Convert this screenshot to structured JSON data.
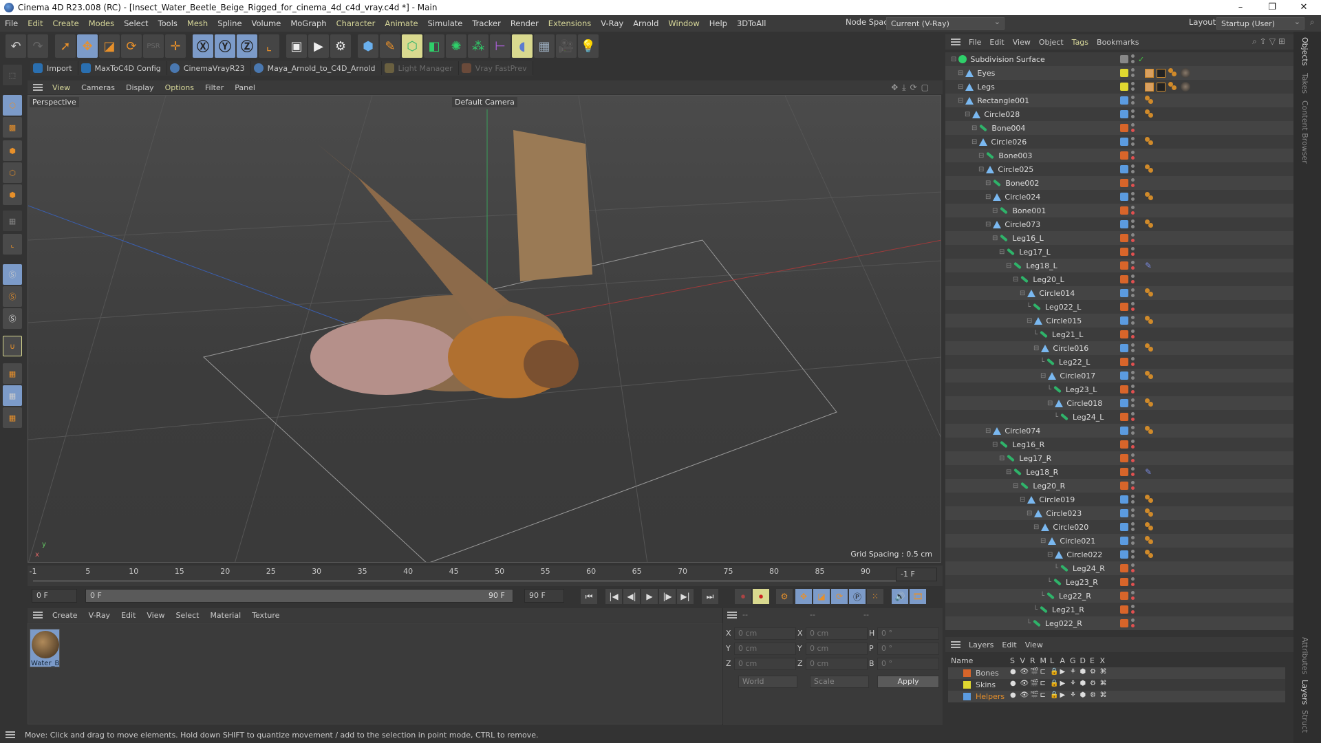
{
  "window": {
    "title": "Cinema 4D R23.008 (RC) - [Insect_Water_Beetle_Beige_Rigged_for_cinema_4d_c4d_vray.c4d *] - Main",
    "minimize": "–",
    "maximize": "❐",
    "close": "✕"
  },
  "menubar": {
    "items": [
      "File",
      "Edit",
      "Create",
      "Modes",
      "Select",
      "Tools",
      "Mesh",
      "Spline",
      "Volume",
      "MoGraph",
      "Character",
      "Animate",
      "Simulate",
      "Tracker",
      "Render",
      "Extensions",
      "V-Ray",
      "Arnold",
      "Window",
      "Help",
      "3DToAll"
    ],
    "node_space_label": "Node Space:",
    "node_space_value": "Current (V-Ray)",
    "layout_label": "Layout:",
    "layout_value": "Startup (User)"
  },
  "plugins": [
    "Import",
    "MaxToC4D Config",
    "CinemaVrayR23",
    "Maya_Arnold_to_C4D_Arnold",
    "Light Manager",
    "Vray FastPrev"
  ],
  "viewport": {
    "menu": [
      "View",
      "Cameras",
      "Display",
      "Options",
      "Filter",
      "Panel"
    ],
    "label": "Perspective",
    "camera": "Default Camera",
    "grid_spacing": "Grid Spacing : 0.5 cm"
  },
  "timeline": {
    "ticks": [
      "-1",
      "5",
      "10",
      "15",
      "20",
      "25",
      "30",
      "35",
      "40",
      "45",
      "50",
      "55",
      "60",
      "65",
      "70",
      "75",
      "80",
      "85",
      "90"
    ],
    "end_field": "-1 F",
    "current_frame": "0 F",
    "slider_start": "0 F",
    "slider_end": "90 F",
    "max_frame": "90 F"
  },
  "material_manager": {
    "menu": [
      "Create",
      "V-Ray",
      "Edit",
      "View",
      "Select",
      "Material",
      "Texture"
    ],
    "materials": [
      {
        "name": "Water_B"
      }
    ]
  },
  "coordinates": {
    "headers": [
      "--",
      "--",
      "--"
    ],
    "pos": {
      "x": "0 cm",
      "y": "0 cm",
      "z": "0 cm"
    },
    "size": {
      "x": "0 cm",
      "y": "0 cm",
      "z": "0 cm"
    },
    "rot": {
      "h": "0 °",
      "p": "0 °",
      "b": "0 °"
    },
    "mode": "World",
    "transform": "Scale",
    "apply": "Apply"
  },
  "status": "Move: Click and drag to move elements. Hold down SHIFT to quantize movement / add to the selection in point mode, CTRL to remove.",
  "object_manager": {
    "menu": [
      "File",
      "Edit",
      "View",
      "Object",
      "Tags",
      "Bookmarks"
    ],
    "objects": [
      {
        "name": "Subdivision Surface",
        "depth": 0,
        "type": "sub",
        "color": "#888888"
      },
      {
        "name": "Eyes",
        "depth": 1,
        "type": "null",
        "color": "#e0d830",
        "tags": "mat"
      },
      {
        "name": "Legs",
        "depth": 1,
        "type": "null",
        "color": "#e0d830",
        "tags": "mat"
      },
      {
        "name": "Rectangle001",
        "depth": 1,
        "type": "null",
        "color": "#5b9be0",
        "tags": "dot"
      },
      {
        "name": "Circle028",
        "depth": 2,
        "type": "null",
        "color": "#5b9be0",
        "tags": "dot"
      },
      {
        "name": "Bone004",
        "depth": 3,
        "type": "bone",
        "color": "#d8652a"
      },
      {
        "name": "Circle026",
        "depth": 3,
        "type": "null",
        "color": "#5b9be0",
        "tags": "dot"
      },
      {
        "name": "Bone003",
        "depth": 4,
        "type": "bone",
        "color": "#d8652a"
      },
      {
        "name": "Circle025",
        "depth": 4,
        "type": "null",
        "color": "#5b9be0",
        "tags": "dot"
      },
      {
        "name": "Bone002",
        "depth": 5,
        "type": "bone",
        "color": "#d8652a"
      },
      {
        "name": "Circle024",
        "depth": 5,
        "type": "null",
        "color": "#5b9be0",
        "tags": "dot"
      },
      {
        "name": "Bone001",
        "depth": 6,
        "type": "bone",
        "color": "#d8652a"
      },
      {
        "name": "Circle073",
        "depth": 5,
        "type": "null",
        "color": "#5b9be0",
        "tags": "dot"
      },
      {
        "name": "Leg16_L",
        "depth": 6,
        "type": "bone",
        "color": "#d8652a"
      },
      {
        "name": "Leg17_L",
        "depth": 7,
        "type": "bone",
        "color": "#d8652a"
      },
      {
        "name": "Leg18_L",
        "depth": 8,
        "type": "bone",
        "color": "#d8652a",
        "tags": "ik"
      },
      {
        "name": "Leg20_L",
        "depth": 9,
        "type": "bone",
        "color": "#d8652a"
      },
      {
        "name": "Circle014",
        "depth": 10,
        "type": "null",
        "color": "#5b9be0",
        "tags": "dot"
      },
      {
        "name": "Leg022_L",
        "depth": 11,
        "type": "bone",
        "color": "#d8652a"
      },
      {
        "name": "Circle015",
        "depth": 11,
        "type": "null",
        "color": "#5b9be0",
        "tags": "dot"
      },
      {
        "name": "Leg21_L",
        "depth": 12,
        "type": "bone",
        "color": "#d8652a"
      },
      {
        "name": "Circle016",
        "depth": 12,
        "type": "null",
        "color": "#5b9be0",
        "tags": "dot"
      },
      {
        "name": "Leg22_L",
        "depth": 13,
        "type": "bone",
        "color": "#d8652a"
      },
      {
        "name": "Circle017",
        "depth": 13,
        "type": "null",
        "color": "#5b9be0",
        "tags": "dot"
      },
      {
        "name": "Leg23_L",
        "depth": 14,
        "type": "bone",
        "color": "#d8652a"
      },
      {
        "name": "Circle018",
        "depth": 14,
        "type": "null",
        "color": "#5b9be0",
        "tags": "dot"
      },
      {
        "name": "Leg24_L",
        "depth": 15,
        "type": "bone",
        "color": "#d8652a"
      },
      {
        "name": "Circle074",
        "depth": 5,
        "type": "null",
        "color": "#5b9be0",
        "tags": "dot"
      },
      {
        "name": "Leg16_R",
        "depth": 6,
        "type": "bone",
        "color": "#d8652a"
      },
      {
        "name": "Leg17_R",
        "depth": 7,
        "type": "bone",
        "color": "#d8652a"
      },
      {
        "name": "Leg18_R",
        "depth": 8,
        "type": "bone",
        "color": "#d8652a",
        "tags": "ik"
      },
      {
        "name": "Leg20_R",
        "depth": 9,
        "type": "bone",
        "color": "#d8652a"
      },
      {
        "name": "Circle019",
        "depth": 10,
        "type": "null",
        "color": "#5b9be0",
        "tags": "dot"
      },
      {
        "name": "Circle023",
        "depth": 11,
        "type": "null",
        "color": "#5b9be0",
        "tags": "dot"
      },
      {
        "name": "Circle020",
        "depth": 12,
        "type": "null",
        "color": "#5b9be0",
        "tags": "dot"
      },
      {
        "name": "Circle021",
        "depth": 13,
        "type": "null",
        "color": "#5b9be0",
        "tags": "dot"
      },
      {
        "name": "Circle022",
        "depth": 14,
        "type": "null",
        "color": "#5b9be0",
        "tags": "dot"
      },
      {
        "name": "Leg24_R",
        "depth": 15,
        "type": "bone",
        "color": "#d8652a"
      },
      {
        "name": "Leg23_R",
        "depth": 14,
        "type": "bone",
        "color": "#d8652a"
      },
      {
        "name": "Leg22_R",
        "depth": 13,
        "type": "bone",
        "color": "#d8652a"
      },
      {
        "name": "Leg21_R",
        "depth": 12,
        "type": "bone",
        "color": "#d8652a"
      },
      {
        "name": "Leg022_R",
        "depth": 11,
        "type": "bone",
        "color": "#d8652a"
      }
    ]
  },
  "layer_manager": {
    "menu": [
      "Layers",
      "Edit",
      "View"
    ],
    "columns": [
      "Name",
      "S",
      "V",
      "R",
      "M",
      "L",
      "A",
      "G",
      "D",
      "E",
      "X"
    ],
    "layers": [
      {
        "name": "Bones",
        "color": "#d8652a",
        "active": false
      },
      {
        "name": "Skins",
        "color": "#e0d830",
        "active": false
      },
      {
        "name": "Helpers",
        "color": "#5b9be0",
        "active": true
      }
    ]
  },
  "side_tabs": {
    "top": [
      "Objects",
      "Takes",
      "Content Browser"
    ],
    "bottom": [
      "Attributes",
      "Layers",
      "Struct"
    ]
  }
}
